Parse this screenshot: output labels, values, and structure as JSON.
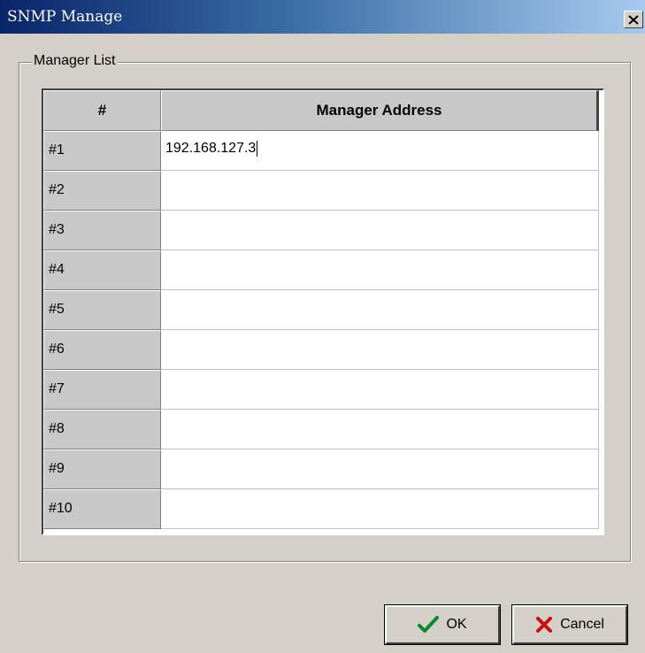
{
  "window": {
    "title": "SNMP Manage"
  },
  "group": {
    "label": "Manager List"
  },
  "table": {
    "headers": [
      "#",
      "Manager Address"
    ],
    "rows": [
      {
        "num": "#1",
        "address": "192.168.127.3"
      },
      {
        "num": "#2",
        "address": ""
      },
      {
        "num": "#3",
        "address": ""
      },
      {
        "num": "#4",
        "address": ""
      },
      {
        "num": "#5",
        "address": ""
      },
      {
        "num": "#6",
        "address": ""
      },
      {
        "num": "#7",
        "address": ""
      },
      {
        "num": "#8",
        "address": ""
      },
      {
        "num": "#9",
        "address": ""
      },
      {
        "num": "#10",
        "address": ""
      }
    ]
  },
  "buttons": {
    "ok": "OK",
    "cancel": "Cancel"
  },
  "icons": {
    "ok": "checkmark-icon",
    "cancel": "x-icon",
    "close": "close-icon"
  },
  "colors": {
    "titlebar_start": "#0a246a",
    "titlebar_end": "#a6caf0",
    "face": "#d4d0c8",
    "check": "#0a8a2a",
    "cross": "#c81010"
  }
}
